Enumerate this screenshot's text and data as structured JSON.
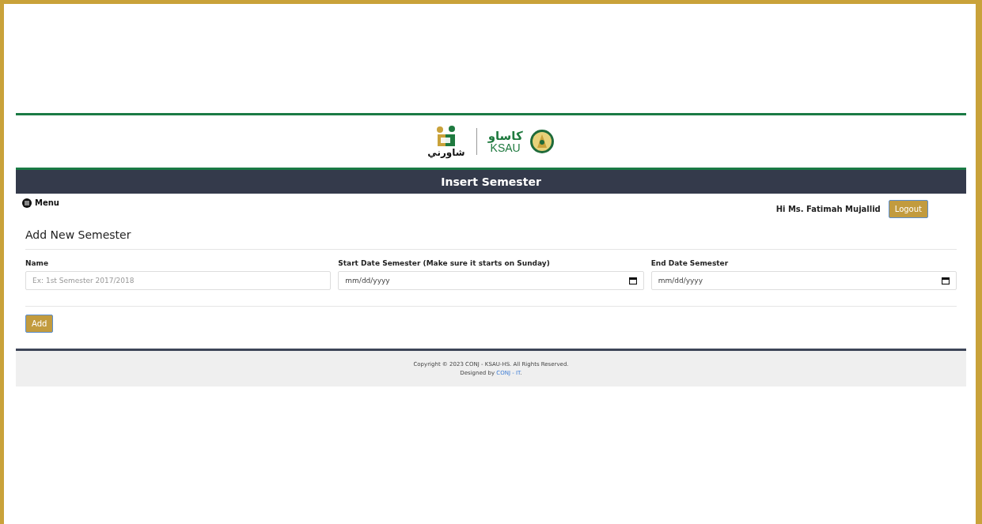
{
  "logo": {
    "app_name": "شاورني",
    "university_arabic": "كاساو",
    "university_latin": "KSAU"
  },
  "title_bar": {
    "title": "Insert Semester"
  },
  "menu": {
    "label": "Menu"
  },
  "user": {
    "greeting": "Hi Ms. Fatimah Mujallid",
    "logout": "Logout"
  },
  "form": {
    "heading": "Add New Semester",
    "fields": [
      {
        "kind": "text",
        "label": "Name",
        "placeholder": "Ex: 1st Semester 2017/2018"
      },
      {
        "kind": "date",
        "label": "Start Date Semester (Make sure it starts on Sunday)",
        "placeholder": "mm/dd/yyyy"
      },
      {
        "kind": "date",
        "label": "End Date Semester",
        "placeholder": "mm/dd/yyyy"
      }
    ],
    "submit": "Add"
  },
  "footer": {
    "copyright": "Copyright © 2023 CONJ - KSAU-HS. All Rights Reserved.",
    "designed_by": "Designed by",
    "designer_link": "CONJ - IT",
    "end": "."
  }
}
